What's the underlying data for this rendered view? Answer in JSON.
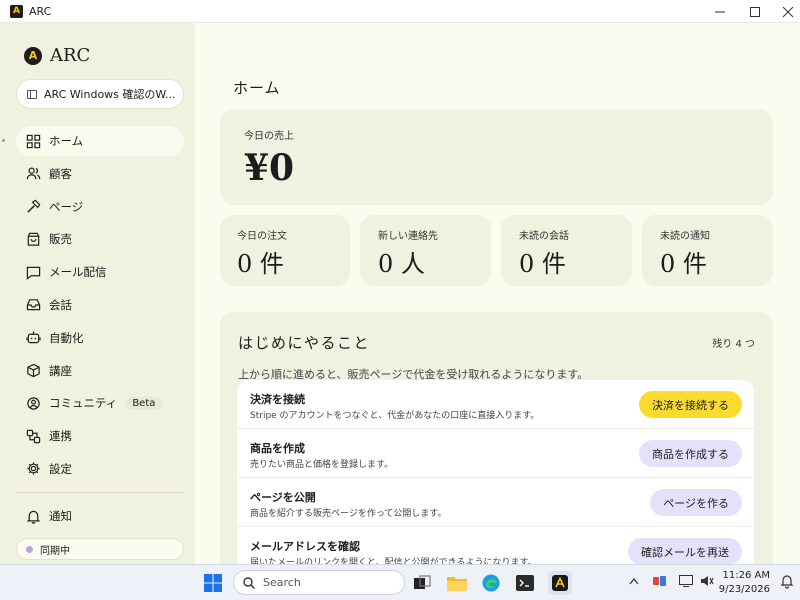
{
  "window": {
    "title": "ARC",
    "app_icon_glyph": "A",
    "controls": [
      "minimize",
      "maximize",
      "close"
    ]
  },
  "sidebar": {
    "brand": {
      "logo_glyph": "A",
      "name": "ARC"
    },
    "site_selector": "ARC Windows 確認のW...",
    "nav": [
      {
        "label": "ホーム",
        "icon": "home-grid-icon",
        "active": true
      },
      {
        "label": "顧客",
        "icon": "users-icon"
      },
      {
        "label": "ページ",
        "icon": "hammer-icon"
      },
      {
        "label": "販売",
        "icon": "shopping-bag-icon"
      },
      {
        "label": "メール配信",
        "icon": "message-icon"
      },
      {
        "label": "会話",
        "icon": "inbox-icon"
      },
      {
        "label": "自動化",
        "icon": "robot-icon"
      },
      {
        "label": "講座",
        "icon": "box-icon"
      },
      {
        "label": "コミュニティ",
        "icon": "community-icon",
        "badge": "Beta"
      },
      {
        "label": "連携",
        "icon": "link-icon"
      },
      {
        "label": "設定",
        "icon": "gear-icon"
      }
    ],
    "notifications_label": "通知",
    "sync_status": "同期中"
  },
  "main": {
    "title": "ホーム",
    "sales_today": {
      "label": "今日の売上",
      "value": "¥0"
    },
    "stats": [
      {
        "label": "今日の注文",
        "value": "0 件"
      },
      {
        "label": "新しい連絡先",
        "value": "0 人"
      },
      {
        "label": "未読の会話",
        "value": "0 件"
      },
      {
        "label": "未読の通知",
        "value": "0 件"
      }
    ],
    "getting_started": {
      "title": "はじめにやること",
      "remaining": "残り 4 つ",
      "description": "上から順に進めると、販売ページで代金を受け取れるようになります。",
      "steps": [
        {
          "title": "決済を接続",
          "desc": "Stripe のアカウントをつなぐと、代金があなたの口座に直接入ります。",
          "button": "決済を接続する",
          "primary": true
        },
        {
          "title": "商品を作成",
          "desc": "売りたい商品と価格を登録します。",
          "button": "商品を作成する"
        },
        {
          "title": "ページを公開",
          "desc": "商品を紹介する販売ページを作って公開します。",
          "button": "ページを作る"
        },
        {
          "title": "メールアドレスを確認",
          "desc": "届いたメールのリンクを開くと、配信と公開ができるようになります。",
          "button": "確認メールを再送"
        }
      ]
    }
  },
  "taskbar": {
    "search_placeholder": "Search",
    "time": "11:26 AM",
    "date": "9/23/2026",
    "colors": {
      "accent": "#fbdc2e",
      "secondary_button": "#e6e1fb"
    }
  }
}
